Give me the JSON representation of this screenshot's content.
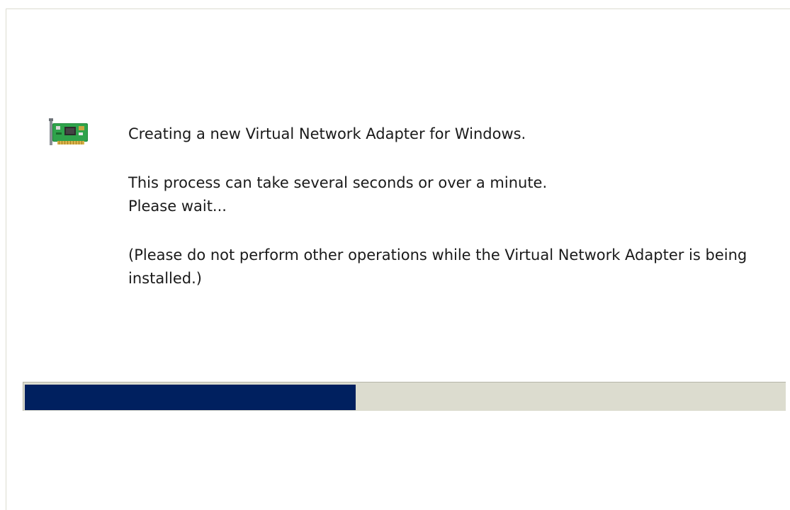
{
  "dialog": {
    "icon": "network-adapter-card-icon",
    "message_title": "Creating a new Virtual Network Adapter for Windows.",
    "message_wait_line1": "This process can take several seconds or over a minute.",
    "message_wait_line2": "Please wait...",
    "message_warning": "(Please do not perform other operations while the Virtual Network Adapter is being installed.)"
  },
  "progress": {
    "fraction": 0.435,
    "fill_color": "#00205f",
    "track_color": "#dcdccf"
  }
}
